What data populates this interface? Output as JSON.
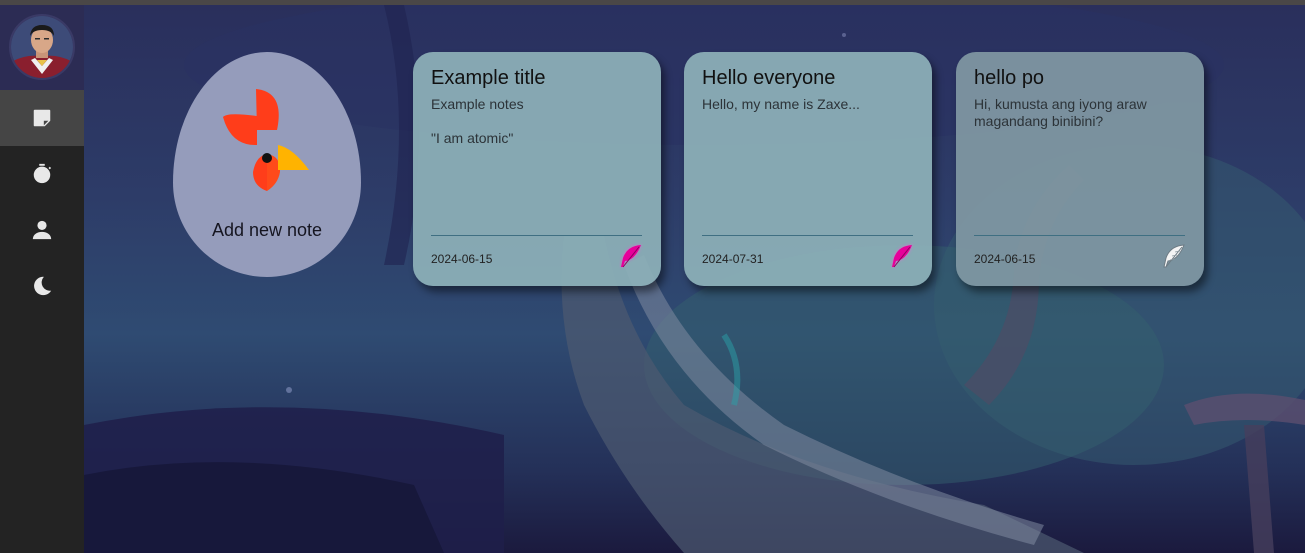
{
  "sidebar": {
    "avatar_alt": "",
    "items": [
      {
        "icon": "note-icon",
        "active": true
      },
      {
        "icon": "stopwatch-icon",
        "active": false
      },
      {
        "icon": "user-icon",
        "active": false
      },
      {
        "icon": "moon-icon",
        "active": false
      }
    ]
  },
  "add_note": {
    "label": "Add new note"
  },
  "notes": [
    {
      "title": "Example title",
      "lines": [
        "Example notes",
        "\"I am atomic\""
      ],
      "date": "2024-06-15",
      "icon": "feather-icon",
      "icon_color": "#e6009a"
    },
    {
      "title": "Hello everyone",
      "lines": [
        "Hello, my name is Zaxe..."
      ],
      "date": "2024-07-31",
      "icon": "feather-icon",
      "icon_color": "#e6009a"
    },
    {
      "title": "hello po",
      "lines": [
        "Hi, kumusta ang iyong araw magandang binibini?"
      ],
      "date": "2024-06-15",
      "icon": "feather-icon",
      "icon_color": "#ffffff"
    }
  ],
  "colors": {
    "sidebar_bg": "#232323",
    "active_item_bg": "#454545",
    "add_note_bg": "#959cbb",
    "logo_red": "#ff3d1a",
    "logo_orange": "#ffb300"
  }
}
